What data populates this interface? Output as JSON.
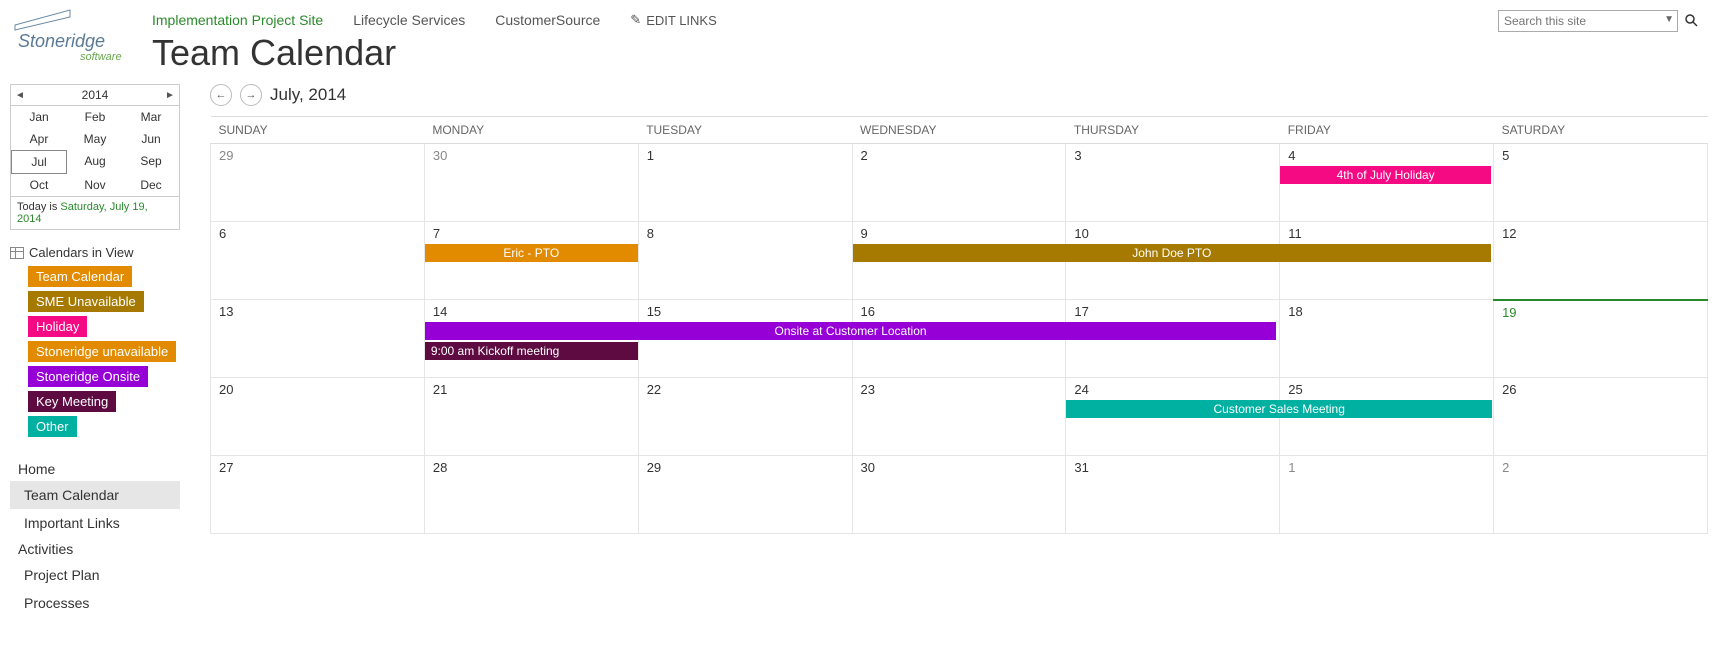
{
  "topNav": {
    "items": [
      "Implementation Project Site",
      "Lifecycle Services",
      "CustomerSource"
    ],
    "editLinks": "EDIT LINKS"
  },
  "pageTitle": "Team Calendar",
  "search": {
    "placeholder": "Search this site"
  },
  "miniCal": {
    "year": "2014",
    "months": [
      "Jan",
      "Feb",
      "Mar",
      "Apr",
      "May",
      "Jun",
      "Jul",
      "Aug",
      "Sep",
      "Oct",
      "Nov",
      "Dec"
    ],
    "selected": "Jul",
    "footerPrefix": "Today is ",
    "footerDate": "Saturday, July 19, 2014"
  },
  "calendarsInView": {
    "title": "Calendars in View",
    "items": [
      "Team Calendar",
      "SME Unavailable",
      "Holiday",
      "Stoneridge unavailable",
      "Stoneridge Onsite",
      "Key Meeting",
      "Other"
    ]
  },
  "leftNav": {
    "groups": [
      {
        "header": "Home",
        "items": [
          "Team Calendar",
          "Important Links"
        ]
      },
      {
        "header": "Activities",
        "items": [
          "Project Plan",
          "Processes"
        ]
      }
    ]
  },
  "calendar": {
    "navLabel": "July, 2014",
    "dayHeaders": [
      "SUNDAY",
      "MONDAY",
      "TUESDAY",
      "WEDNESDAY",
      "THURSDAY",
      "FRIDAY",
      "SATURDAY"
    ],
    "weeks": [
      [
        "29",
        "30",
        "1",
        "2",
        "3",
        "4",
        "5"
      ],
      [
        "6",
        "7",
        "8",
        "9",
        "10",
        "11",
        "12"
      ],
      [
        "13",
        "14",
        "15",
        "16",
        "17",
        "18",
        "19"
      ],
      [
        "20",
        "21",
        "22",
        "23",
        "24",
        "25",
        "26"
      ],
      [
        "27",
        "28",
        "29",
        "30",
        "31",
        "1",
        "2"
      ]
    ],
    "events": {
      "holiday": "4th of July Holiday",
      "ericPto": "Eric - PTO",
      "johnPto": "John Doe PTO",
      "onsite": "Onsite at Customer Location",
      "kickoff": "9:00 am Kickoff meeting",
      "customerSales": "Customer Sales Meeting"
    }
  }
}
